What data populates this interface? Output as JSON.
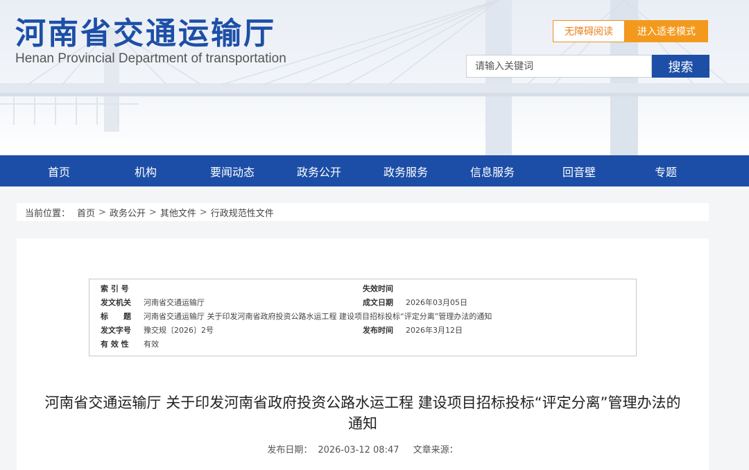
{
  "header": {
    "title": "河南省交通运输厅",
    "subtitle": "Henan Provincial Department of transportation",
    "accessible_label": "无障碍阅读",
    "elder_label": "进入适老模式",
    "search": {
      "placeholder": "请输入关键词",
      "button": "搜索"
    }
  },
  "nav": {
    "items": [
      {
        "label": "首页"
      },
      {
        "label": "机构"
      },
      {
        "label": "要闻动态"
      },
      {
        "label": "政务公开"
      },
      {
        "label": "政务服务"
      },
      {
        "label": "信息服务"
      },
      {
        "label": "回音壁"
      },
      {
        "label": "专题"
      }
    ]
  },
  "breadcrumb": {
    "lead": "当前位置：",
    "items": [
      "首页",
      "政务公开",
      "其他文件",
      "行政规范性文件"
    ],
    "separator": ">"
  },
  "meta": {
    "index_label": "索 引 号",
    "index_value": "",
    "expire_label": "失效时间",
    "expire_value": "",
    "issuer_label": "发文机关",
    "issuer_value": "河南省交通运输厅",
    "made_label": "成文日期",
    "made_value": "2026年03月05日",
    "title_label": "标　　题",
    "title_value": "河南省交通运输厅 关于印发河南省政府投资公路水运工程 建设项目招标投标“评定分离”管理办法的通知",
    "doc_no_label": "发文字号",
    "doc_no_value": "豫交规〔2026〕2号",
    "publish_label": "发布时间",
    "publish_value": "2026年3月12日",
    "validity_label": "有 效 性",
    "validity_value": "有效"
  },
  "article": {
    "title": "河南省交通运输厅 关于印发河南省政府投资公路水运工程 建设项目招标投标“评定分离”管理办法的通知",
    "date_label": "发布日期：",
    "date_value": "2026-03-12 08:47",
    "source_label": "文章来源："
  },
  "colors": {
    "brand_blue": "#1d4fa6",
    "nav_blue": "#1c4ea7",
    "accent_orange": "#f39a1e"
  }
}
